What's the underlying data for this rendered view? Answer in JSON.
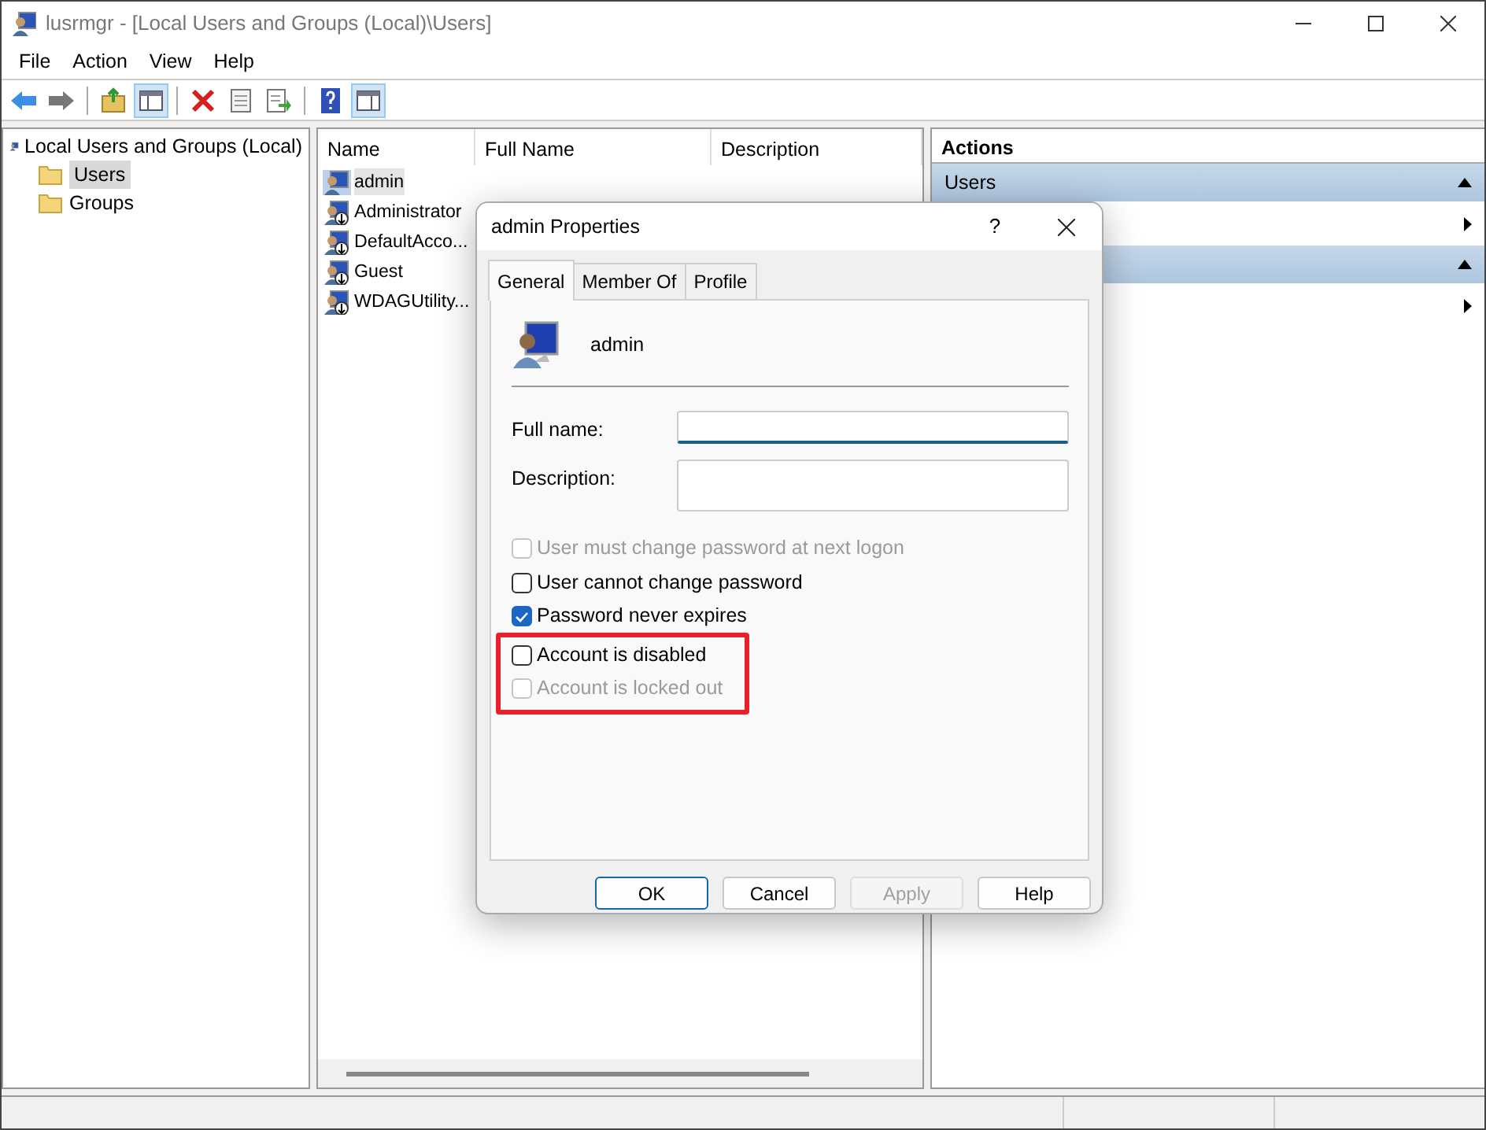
{
  "window": {
    "title": "lusrmgr - [Local Users and Groups (Local)\\Users]"
  },
  "menu": [
    "File",
    "Action",
    "View",
    "Help"
  ],
  "toolbar": [
    {
      "kind": "back",
      "pressed": false
    },
    {
      "kind": "forward",
      "pressed": false
    },
    {
      "kind": "separator"
    },
    {
      "kind": "up",
      "pressed": false
    },
    {
      "kind": "tree",
      "pressed": true
    },
    {
      "kind": "separator"
    },
    {
      "kind": "delete",
      "pressed": false
    },
    {
      "kind": "properties",
      "pressed": false
    },
    {
      "kind": "export",
      "pressed": false
    },
    {
      "kind": "separator"
    },
    {
      "kind": "help",
      "pressed": false
    },
    {
      "kind": "actionpane",
      "pressed": true
    }
  ],
  "tree": {
    "label": "Local Users and Groups (Local)",
    "children": [
      {
        "label": "Users",
        "selected": true
      },
      {
        "label": "Groups",
        "selected": false
      }
    ]
  },
  "list": {
    "columns": [
      "Name",
      "Full Name",
      "Description"
    ],
    "rows": [
      {
        "name": "admin",
        "selected": true,
        "account_disabled": false
      },
      {
        "name": "Administrator",
        "selected": false,
        "account_disabled": true
      },
      {
        "name": "DefaultAcco...",
        "selected": false,
        "account_disabled": true
      },
      {
        "name": "Guest",
        "selected": false,
        "account_disabled": true
      },
      {
        "name": "WDAGUtility...",
        "selected": false,
        "account_disabled": true
      }
    ]
  },
  "actions": {
    "title": "Actions",
    "rows": [
      {
        "kind": "header",
        "label": "Users"
      },
      {
        "kind": "item"
      },
      {
        "kind": "header"
      },
      {
        "kind": "item"
      }
    ]
  },
  "dialog": {
    "title": "admin Properties",
    "help": "?",
    "tabs": [
      {
        "label": "General",
        "selected": true
      },
      {
        "label": "Member Of",
        "selected": false
      },
      {
        "label": "Profile",
        "selected": false
      }
    ],
    "user": "admin",
    "fields": [
      {
        "label": "Full name:",
        "focused": true,
        "multiline": false
      },
      {
        "label": "Description:",
        "focused": false,
        "multiline": true
      }
    ],
    "checkboxes": [
      {
        "label": "User must change password at next logon",
        "checked": false,
        "disabled": true,
        "highlighted": false
      },
      {
        "label": "User cannot change password",
        "checked": false,
        "disabled": false,
        "highlighted": false
      },
      {
        "label": "Password never expires",
        "checked": true,
        "disabled": false,
        "highlighted": false
      },
      {
        "label": "Account is disabled",
        "checked": false,
        "disabled": false,
        "highlighted": true
      },
      {
        "label": "Account is locked out",
        "checked": false,
        "disabled": true,
        "highlighted": true
      }
    ],
    "buttons": [
      {
        "label": "OK",
        "default": true,
        "disabled": false
      },
      {
        "label": "Cancel",
        "default": false,
        "disabled": false
      },
      {
        "label": "Apply",
        "default": false,
        "disabled": true
      },
      {
        "label": "Help",
        "default": false,
        "disabled": false
      }
    ]
  }
}
